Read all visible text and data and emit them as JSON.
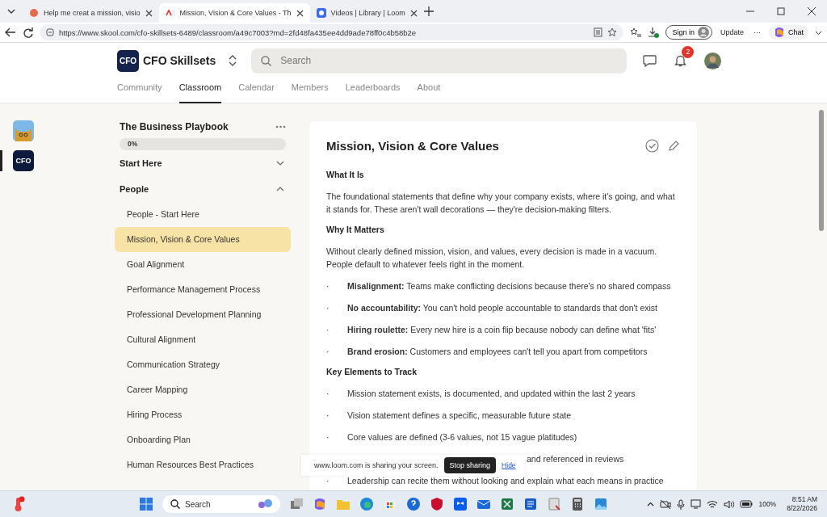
{
  "browser": {
    "tabs": [
      {
        "title": "Help me creat a mission, visio",
        "selected": false
      },
      {
        "title": "Mission, Vision & Core Values - Th",
        "selected": true
      },
      {
        "title": "Videos | Library | Loom",
        "selected": false
      }
    ],
    "url": "https://www.skool.com/cfo-skillsets-6489/classroom/a49c7003?md=2fd48fa435ee4dd9ade78ff0c4b58b2e",
    "sign_in": "Sign in",
    "update": "Update",
    "more": "···",
    "chat": "Chat"
  },
  "header": {
    "logo": "CFO",
    "group_name": "CFO Skillsets",
    "search": {
      "placeholder": "Search"
    },
    "notifications": "2",
    "nav": [
      {
        "label": "Community",
        "selected": false
      },
      {
        "label": "Classroom",
        "selected": true
      },
      {
        "label": "Calendar",
        "selected": false
      },
      {
        "label": "Members",
        "selected": false
      },
      {
        "label": "Leaderboards",
        "selected": false
      },
      {
        "label": "About",
        "selected": false
      }
    ]
  },
  "rail": [
    {
      "kind": "cat",
      "selected": false
    },
    {
      "kind": "cfo",
      "label": "CFO",
      "selected": true
    }
  ],
  "course": {
    "title": "The Business Playbook",
    "progress": {
      "reading": "0%",
      "level": 0
    },
    "sections": [
      {
        "title": "Start Here",
        "expanded": false
      },
      {
        "title": "People",
        "expanded": true,
        "children": [
          {
            "title": "People - Start Here",
            "selected": false
          },
          {
            "title": "Mission, Vision & Core Values",
            "selected": true
          },
          {
            "title": "Goal Alignment",
            "selected": false
          },
          {
            "title": "Performance Management Process",
            "selected": false
          },
          {
            "title": "Professional Development Planning",
            "selected": false
          },
          {
            "title": "Cultural Alignment",
            "selected": false
          },
          {
            "title": "Communication Strategy",
            "selected": false
          },
          {
            "title": "Career Mapping",
            "selected": false
          },
          {
            "title": "Hiring Process",
            "selected": false
          },
          {
            "title": "Onboarding Plan",
            "selected": false
          },
          {
            "title": "Human Resources Best Practices",
            "selected": false
          }
        ]
      }
    ]
  },
  "lesson": {
    "title": "Mission, Vision & Core Values",
    "completed": false,
    "blocks": [
      {
        "kind": "heading",
        "text": "What It Is"
      },
      {
        "kind": "paragraph",
        "text": "The foundational statements that define why your company exists, where it's going, and what it stands for. These aren't wall decorations — they're decision-making filters."
      },
      {
        "kind": "heading",
        "text": "Why It Matters"
      },
      {
        "kind": "paragraph",
        "text": "Without clearly defined mission, vision, and values, every decision is made in a vacuum. People default to whatever feels right in the moment."
      },
      {
        "kind": "bullet",
        "bullet": "·",
        "text": "**Misalignment:** Teams make conflicting decisions because there's no shared compass"
      },
      {
        "kind": "bullet",
        "bullet": "·",
        "text": "**No accountability:** You can't hold people accountable to standards that don't exist"
      },
      {
        "kind": "bullet",
        "bullet": "·",
        "text": "**Hiring roulette:** Every new hire is a coin flip because nobody can define what 'fits'"
      },
      {
        "kind": "bullet",
        "bullet": "·",
        "text": "**Brand erosion:** Customers and employees can't tell you apart from competitors"
      },
      {
        "kind": "heading",
        "text": "Key Elements to Track"
      },
      {
        "kind": "bullet",
        "bullet": "·",
        "text": "Mission statement exists, is documented, and updated within the last 2 years"
      },
      {
        "kind": "bullet",
        "bullet": "·",
        "text": "Vision statement defines a specific, measurable future state"
      },
      {
        "kind": "bullet",
        "bullet": "·",
        "text": "Core values are defined (3-6 values, not 15 vague platitudes)"
      },
      {
        "kind": "covered",
        "text": "and referenced in reviews"
      },
      {
        "kind": "bullet",
        "bullet": "·",
        "text": "Leadership can recite them without looking and explain what each means in practice"
      }
    ]
  },
  "share_banner": {
    "message": "www.loom.com is sharing your screen.",
    "stop": "Stop sharing",
    "hide": "Hide"
  },
  "taskbar": {
    "search": {
      "placeholder": "Search"
    },
    "battery": "100%",
    "time": "8:51 AM",
    "date": "8/22/2026"
  }
}
